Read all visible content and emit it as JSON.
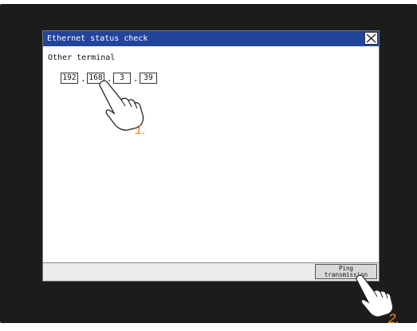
{
  "dialog": {
    "title": "Ethernet status check",
    "close_icon": "close-icon",
    "label": "Other terminal",
    "ip": [
      "192",
      "168",
      "3",
      "39"
    ],
    "separator": "."
  },
  "footer": {
    "ping_line1": "Ping",
    "ping_line2": "transmission"
  },
  "steps": {
    "step1": "1.",
    "step2": "2."
  },
  "colors": {
    "titlebar": "#22449a",
    "step_label": "#f08a1c",
    "bezel": "#1c1c1c"
  }
}
